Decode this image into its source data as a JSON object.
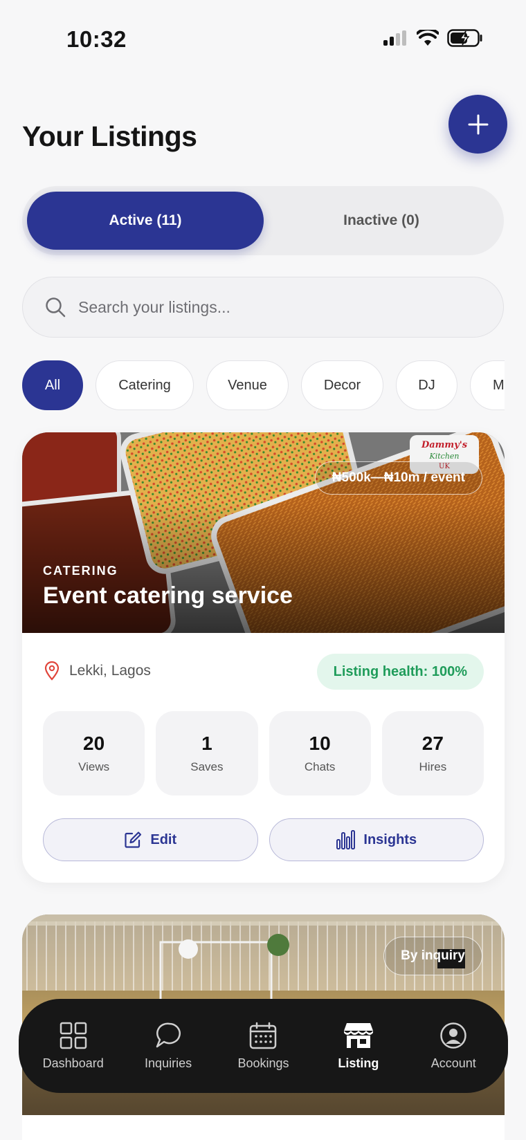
{
  "status_bar": {
    "time": "10:32"
  },
  "header": {
    "title": "Your Listings"
  },
  "tabs": {
    "active": "Active (11)",
    "inactive": "Inactive (0)"
  },
  "search": {
    "placeholder": "Search your listings..."
  },
  "filters": [
    "All",
    "Catering",
    "Venue",
    "Decor",
    "DJ",
    "MC"
  ],
  "listings": [
    {
      "category": "CATERING",
      "title": "Event catering service",
      "price": "₦500k—₦10m / event",
      "brand_logo": "Dammy's Kitchen UK",
      "location": "Lekki, Lagos",
      "health": "Listing health: 100%",
      "stats": [
        {
          "value": "20",
          "label": "Views"
        },
        {
          "value": "1",
          "label": "Saves"
        },
        {
          "value": "10",
          "label": "Chats"
        },
        {
          "value": "27",
          "label": "Hires"
        }
      ],
      "actions": {
        "edit": "Edit",
        "insights": "Insights"
      }
    },
    {
      "price": "By inquiry"
    }
  ],
  "nav": [
    {
      "label": "Dashboard",
      "icon": "grid-icon"
    },
    {
      "label": "Inquiries",
      "icon": "chat-icon"
    },
    {
      "label": "Bookings",
      "icon": "calendar-icon"
    },
    {
      "label": "Listing",
      "icon": "store-icon"
    },
    {
      "label": "Account",
      "icon": "user-icon"
    }
  ],
  "colors": {
    "accent": "#2b3593",
    "success_bg": "#e3f6ec",
    "success_text": "#1f9c5a",
    "nav_bg": "#171717"
  }
}
